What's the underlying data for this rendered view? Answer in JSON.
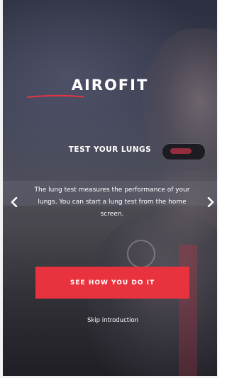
{
  "brand": {
    "logo_text": "AIROFIT",
    "accent_color": "#e8333f"
  },
  "onboarding": {
    "title": "TEST YOUR LUNGS",
    "description": "The lung test measures the performance of your lungs. You can start a lung test from the home screen.",
    "cta_label": "SEE HOW YOU DO IT",
    "skip_label": "Skip introduction",
    "prev_icon": "chevron-left-icon",
    "next_icon": "chevron-right-icon"
  }
}
